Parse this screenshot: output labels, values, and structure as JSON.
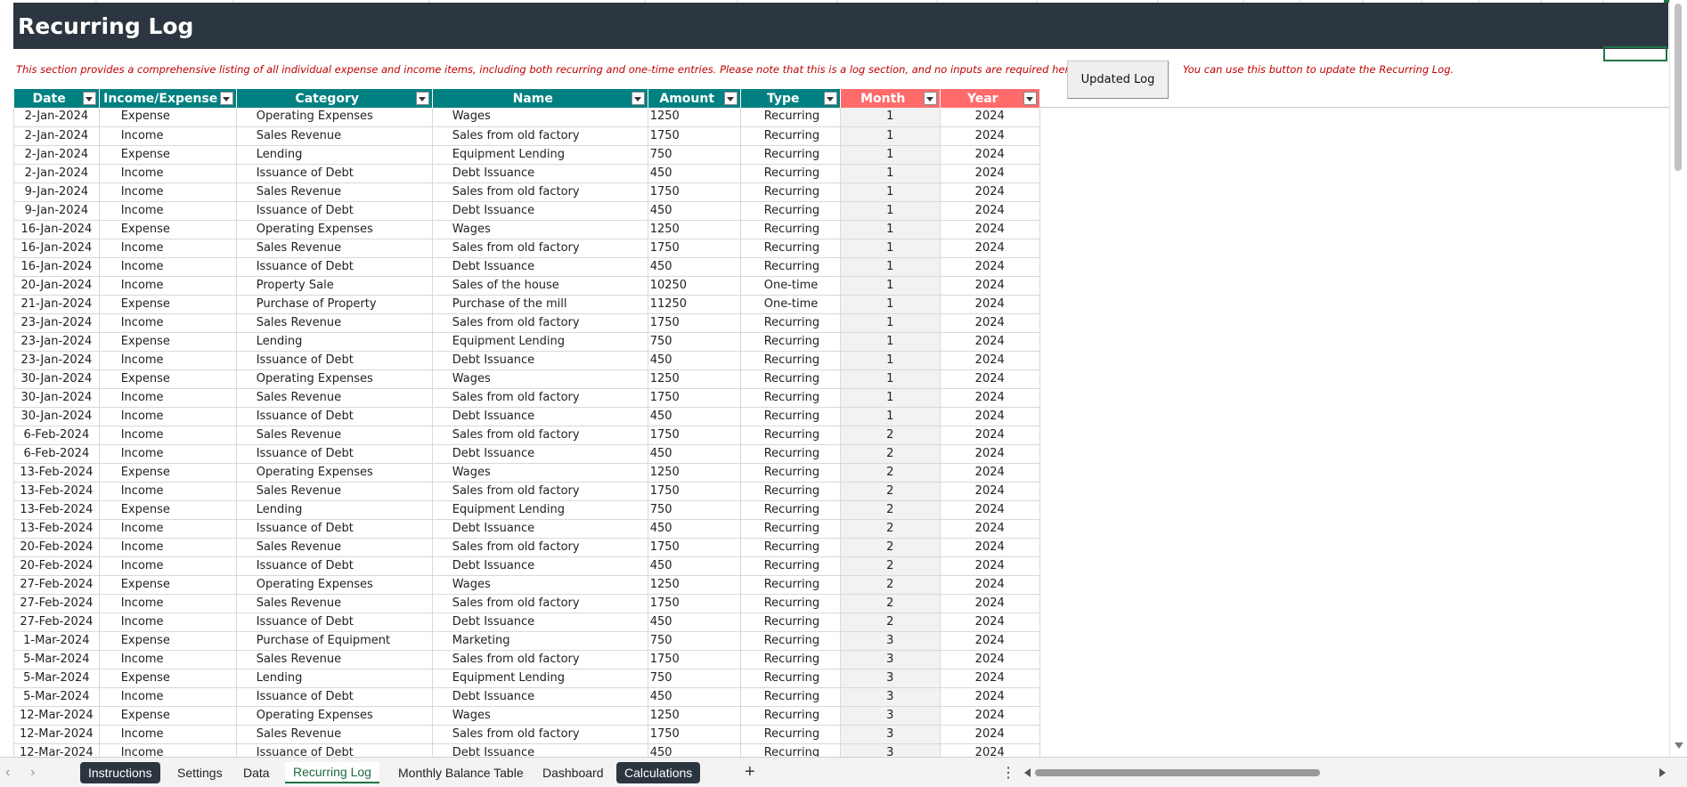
{
  "sheet": {
    "title": "Recurring Log",
    "description": "This section provides a comprehensive listing of all individual expense and income items, including both recurring and one-time entries. Please note that this is a log section, and no inputs are required here.",
    "update_button_label": "Updated Log",
    "update_note": "You can use this button to update the Recurring Log."
  },
  "columns": [
    "Date",
    "Income/Expense",
    "Category",
    "Name",
    "Amount",
    "Type",
    "Month",
    "Year"
  ],
  "rows": [
    [
      "2-Jan-2024",
      "Expense",
      "Operating Expenses",
      "Wages",
      "1250",
      "Recurring",
      "1",
      "2024"
    ],
    [
      "2-Jan-2024",
      "Income",
      "Sales Revenue",
      "Sales from old factory",
      "1750",
      "Recurring",
      "1",
      "2024"
    ],
    [
      "2-Jan-2024",
      "Expense",
      "Lending",
      "Equipment Lending",
      "750",
      "Recurring",
      "1",
      "2024"
    ],
    [
      "2-Jan-2024",
      "Income",
      "Issuance of Debt",
      "Debt Issuance",
      "450",
      "Recurring",
      "1",
      "2024"
    ],
    [
      "9-Jan-2024",
      "Income",
      "Sales Revenue",
      "Sales from old factory",
      "1750",
      "Recurring",
      "1",
      "2024"
    ],
    [
      "9-Jan-2024",
      "Income",
      "Issuance of Debt",
      "Debt Issuance",
      "450",
      "Recurring",
      "1",
      "2024"
    ],
    [
      "16-Jan-2024",
      "Expense",
      "Operating Expenses",
      "Wages",
      "1250",
      "Recurring",
      "1",
      "2024"
    ],
    [
      "16-Jan-2024",
      "Income",
      "Sales Revenue",
      "Sales from old factory",
      "1750",
      "Recurring",
      "1",
      "2024"
    ],
    [
      "16-Jan-2024",
      "Income",
      "Issuance of Debt",
      "Debt Issuance",
      "450",
      "Recurring",
      "1",
      "2024"
    ],
    [
      "20-Jan-2024",
      "Income",
      "Property Sale",
      "Sales of the house",
      "10250",
      "One-time",
      "1",
      "2024"
    ],
    [
      "21-Jan-2024",
      "Expense",
      "Purchase of Property",
      "Purchase of the mill",
      "11250",
      "One-time",
      "1",
      "2024"
    ],
    [
      "23-Jan-2024",
      "Income",
      "Sales Revenue",
      "Sales from old factory",
      "1750",
      "Recurring",
      "1",
      "2024"
    ],
    [
      "23-Jan-2024",
      "Expense",
      "Lending",
      "Equipment Lending",
      "750",
      "Recurring",
      "1",
      "2024"
    ],
    [
      "23-Jan-2024",
      "Income",
      "Issuance of Debt",
      "Debt Issuance",
      "450",
      "Recurring",
      "1",
      "2024"
    ],
    [
      "30-Jan-2024",
      "Expense",
      "Operating Expenses",
      "Wages",
      "1250",
      "Recurring",
      "1",
      "2024"
    ],
    [
      "30-Jan-2024",
      "Income",
      "Sales Revenue",
      "Sales from old factory",
      "1750",
      "Recurring",
      "1",
      "2024"
    ],
    [
      "30-Jan-2024",
      "Income",
      "Issuance of Debt",
      "Debt Issuance",
      "450",
      "Recurring",
      "1",
      "2024"
    ],
    [
      "6-Feb-2024",
      "Income",
      "Sales Revenue",
      "Sales from old factory",
      "1750",
      "Recurring",
      "2",
      "2024"
    ],
    [
      "6-Feb-2024",
      "Income",
      "Issuance of Debt",
      "Debt Issuance",
      "450",
      "Recurring",
      "2",
      "2024"
    ],
    [
      "13-Feb-2024",
      "Expense",
      "Operating Expenses",
      "Wages",
      "1250",
      "Recurring",
      "2",
      "2024"
    ],
    [
      "13-Feb-2024",
      "Income",
      "Sales Revenue",
      "Sales from old factory",
      "1750",
      "Recurring",
      "2",
      "2024"
    ],
    [
      "13-Feb-2024",
      "Expense",
      "Lending",
      "Equipment Lending",
      "750",
      "Recurring",
      "2",
      "2024"
    ],
    [
      "13-Feb-2024",
      "Income",
      "Issuance of Debt",
      "Debt Issuance",
      "450",
      "Recurring",
      "2",
      "2024"
    ],
    [
      "20-Feb-2024",
      "Income",
      "Sales Revenue",
      "Sales from old factory",
      "1750",
      "Recurring",
      "2",
      "2024"
    ],
    [
      "20-Feb-2024",
      "Income",
      "Issuance of Debt",
      "Debt Issuance",
      "450",
      "Recurring",
      "2",
      "2024"
    ],
    [
      "27-Feb-2024",
      "Expense",
      "Operating Expenses",
      "Wages",
      "1250",
      "Recurring",
      "2",
      "2024"
    ],
    [
      "27-Feb-2024",
      "Income",
      "Sales Revenue",
      "Sales from old factory",
      "1750",
      "Recurring",
      "2",
      "2024"
    ],
    [
      "27-Feb-2024",
      "Income",
      "Issuance of Debt",
      "Debt Issuance",
      "450",
      "Recurring",
      "2",
      "2024"
    ],
    [
      "1-Mar-2024",
      "Expense",
      "Purchase of Equipment",
      "Marketing",
      "750",
      "Recurring",
      "3",
      "2024"
    ],
    [
      "5-Mar-2024",
      "Income",
      "Sales Revenue",
      "Sales from old factory",
      "1750",
      "Recurring",
      "3",
      "2024"
    ],
    [
      "5-Mar-2024",
      "Expense",
      "Lending",
      "Equipment Lending",
      "750",
      "Recurring",
      "3",
      "2024"
    ],
    [
      "5-Mar-2024",
      "Income",
      "Issuance of Debt",
      "Debt Issuance",
      "450",
      "Recurring",
      "3",
      "2024"
    ],
    [
      "12-Mar-2024",
      "Expense",
      "Operating Expenses",
      "Wages",
      "1250",
      "Recurring",
      "3",
      "2024"
    ],
    [
      "12-Mar-2024",
      "Income",
      "Sales Revenue",
      "Sales from old factory",
      "1750",
      "Recurring",
      "3",
      "2024"
    ],
    [
      "12-Mar-2024",
      "Income",
      "Issuance of Debt",
      "Debt Issuance",
      "450",
      "Recurring",
      "3",
      "2024"
    ]
  ],
  "tabs": [
    {
      "label": "Instructions",
      "style": "dark"
    },
    {
      "label": "Settings",
      "style": "plain"
    },
    {
      "label": "Data",
      "style": "plain"
    },
    {
      "label": "Recurring Log",
      "style": "active"
    },
    {
      "label": "Monthly Balance Table",
      "style": "plain"
    },
    {
      "label": "Dashboard",
      "style": "plain"
    },
    {
      "label": "Calculations",
      "style": "dark"
    }
  ],
  "icons": {
    "prev_sheet": "chevron-left-icon",
    "next_sheet": "chevron-right-icon",
    "add_sheet": "plus-icon",
    "more": "vertical-dots-icon",
    "filter": "filter-dropdown-icon"
  },
  "colors": {
    "title_bg": "#2b3640",
    "header_teal": "#008080",
    "header_red": "#ff6b6b",
    "note_red": "#c00000",
    "active_tab": "#217346"
  }
}
